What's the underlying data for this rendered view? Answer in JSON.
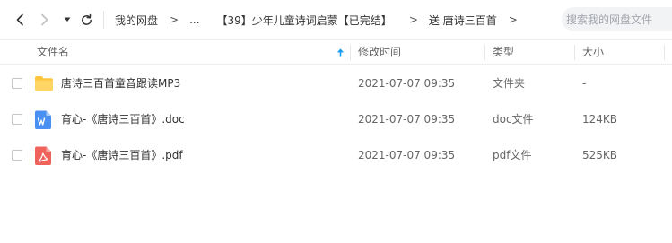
{
  "breadcrumb": {
    "items": [
      "我的网盘",
      "...",
      "【39】少年儿童诗词启蒙【已完结】",
      "送 唐诗三百首"
    ],
    "separator": ">"
  },
  "search": {
    "placeholder": "搜索我的网盘文件"
  },
  "table": {
    "columns": {
      "name": "文件名",
      "modified": "修改时间",
      "type": "类型",
      "size": "大小"
    },
    "rows": [
      {
        "name": "唐诗三百首童音跟读MP3",
        "modified": "2021-07-07 09:35",
        "type": "文件夹",
        "size": "-",
        "icon": "folder-icon"
      },
      {
        "name": "育心-《唐诗三百首》.doc",
        "modified": "2021-07-07 09:35",
        "type": "doc文件",
        "size": "124KB",
        "icon": "word-doc-icon"
      },
      {
        "name": "育心-《唐诗三百首》.pdf",
        "modified": "2021-07-07 09:35",
        "type": "pdf文件",
        "size": "525KB",
        "icon": "pdf-icon"
      }
    ]
  },
  "colors": {
    "accent": "#1a9af0",
    "folder": "#ffc53d",
    "word": "#4a8ff2",
    "pdf": "#f0625c"
  }
}
